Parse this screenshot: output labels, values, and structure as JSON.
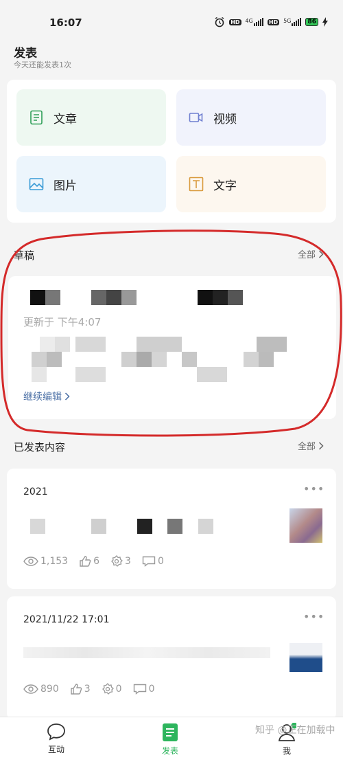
{
  "status_bar": {
    "time": "16:07",
    "net1": "4G",
    "net2": "5G",
    "hd": "HD",
    "battery": "86",
    "icons": [
      "alarm-icon",
      "signal-icon",
      "battery-icon",
      "charging-icon"
    ]
  },
  "header": {
    "title": "发表",
    "subtitle": "今天还能发表1次"
  },
  "publish_options": [
    {
      "label": "文章",
      "icon": "article-icon",
      "bg": "#eef8f1",
      "color": "#2e9e57"
    },
    {
      "label": "视频",
      "icon": "video-icon",
      "bg": "#f1f3fc",
      "color": "#6f7fd0"
    },
    {
      "label": "图片",
      "icon": "image-icon",
      "bg": "#ecf5fc",
      "color": "#3a9bd6"
    },
    {
      "label": "文字",
      "icon": "text-icon",
      "bg": "#fdf7ef",
      "color": "#d99a3c"
    }
  ],
  "drafts": {
    "section_title": "草稿",
    "more_label": "全部",
    "updated": "更新于 下午4:07",
    "continue_label": "继续编辑",
    "annotation_color": "#d42a2a"
  },
  "published": {
    "section_title": "已发表内容",
    "more_label": "全部",
    "items": [
      {
        "date": "2021",
        "views": "1,153",
        "likes": "6",
        "shares": "3",
        "comments": "0"
      },
      {
        "date": "2021/11/22 17:01",
        "views": "890",
        "likes": "3",
        "shares": "0",
        "comments": "0"
      }
    ]
  },
  "nav": {
    "items": [
      {
        "label": "互动",
        "icon": "chat-icon",
        "active": false
      },
      {
        "label": "发表",
        "icon": "publish-icon",
        "active": true
      },
      {
        "label": "我",
        "icon": "profile-icon",
        "active": false
      }
    ],
    "accent": "#2db55d"
  },
  "watermark": "知乎 @正在加载中"
}
